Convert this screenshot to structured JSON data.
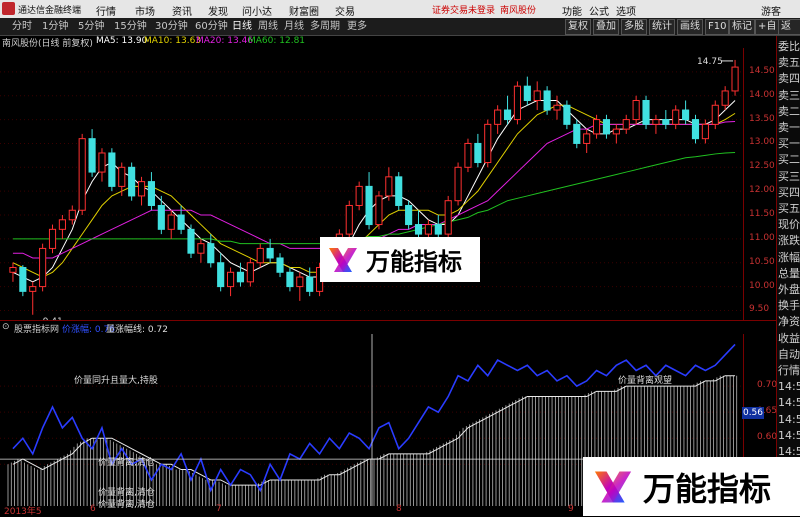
{
  "menubar": {
    "app_title": "通达信金融终端",
    "menus": [
      "行情",
      "市场",
      "资讯",
      "发现",
      "问小达",
      "财富圈",
      "交易"
    ],
    "notice": "证券交易未登录",
    "stock": "南风股份",
    "right": [
      "功能",
      "公式",
      "选项"
    ],
    "guest": "游客"
  },
  "toolbar": {
    "periods": [
      "分时",
      "1分钟",
      "5分钟",
      "15分钟",
      "30分钟",
      "60分钟",
      "日线",
      "周线",
      "月线",
      "多周期",
      "更多"
    ],
    "selected": "日线",
    "buttons": [
      "复权",
      "叠加",
      "多股",
      "统计",
      "画线",
      "F10",
      "标记",
      "+自选",
      "返回"
    ]
  },
  "chart_header": {
    "name": "南风股份(日线 前复权)",
    "ma": [
      {
        "label": "MA5: 13.90",
        "color": "#ffffff"
      },
      {
        "label": "MA10: 13.63",
        "color": "#e0d000"
      },
      {
        "label": "MA20: 13.46",
        "color": "#e020e0"
      },
      {
        "label": "MA60: 12.81",
        "color": "#20c020"
      }
    ]
  },
  "price_axis": [
    "14.50",
    "14.00",
    "13.50",
    "13.00",
    "12.50",
    "12.00",
    "11.50",
    "11.00",
    "10.50",
    "10.00",
    "9.50"
  ],
  "price_labels": {
    "high": "14.75",
    "low": "9.41"
  },
  "right_panel": [
    "委比",
    "卖五",
    "卖四",
    "卖三",
    "卖二",
    "卖一",
    "买一",
    "买二",
    "买三",
    "买四",
    "买五",
    "现价",
    "涨跌",
    "涨幅",
    "总量",
    "外盘",
    "换手",
    "净资",
    "收益",
    "自动",
    "行情",
    "14:5",
    "14:5",
    "14:5",
    "14:5",
    "14:5",
    "14:5",
    "14:5",
    "14:5"
  ],
  "indicator": {
    "name": "股票指标网",
    "line1": "价涨幅: 0.76",
    "line2": "量涨幅线: 0.72",
    "axis": [
      "0.70",
      "0.65",
      "0.60",
      "0.55",
      "0.50"
    ],
    "readout": "0.56",
    "annotations": [
      "价量同升且量大,持股",
      "价量背离,清仓",
      "价量背离,清仓",
      "价量背离,清仓",
      "价量背离观望"
    ]
  },
  "dates": [
    "2013年5",
    "6",
    "7",
    "8",
    "9",
    "10"
  ],
  "watermark": "万能指标",
  "chart_data": {
    "type": "candlestick",
    "y_range": [
      9.3,
      15.0
    ],
    "candles": [
      [
        10.3,
        10.5,
        10.1,
        10.4
      ],
      [
        10.4,
        10.45,
        9.8,
        9.9
      ],
      [
        9.9,
        10.1,
        9.41,
        10.0
      ],
      [
        10.0,
        10.9,
        9.9,
        10.8
      ],
      [
        10.8,
        11.3,
        10.7,
        11.2
      ],
      [
        11.2,
        11.5,
        11.0,
        11.4
      ],
      [
        11.4,
        11.7,
        11.3,
        11.6
      ],
      [
        11.6,
        13.2,
        11.5,
        13.1
      ],
      [
        13.1,
        13.3,
        12.3,
        12.4
      ],
      [
        12.4,
        12.9,
        12.2,
        12.8
      ],
      [
        12.8,
        12.9,
        12.0,
        12.1
      ],
      [
        12.1,
        12.6,
        11.9,
        12.5
      ],
      [
        12.5,
        12.6,
        11.8,
        11.9
      ],
      [
        11.9,
        12.3,
        11.7,
        12.2
      ],
      [
        12.2,
        12.4,
        11.6,
        11.7
      ],
      [
        11.7,
        11.9,
        11.1,
        11.2
      ],
      [
        11.2,
        11.6,
        11.0,
        11.5
      ],
      [
        11.5,
        11.7,
        11.1,
        11.2
      ],
      [
        11.2,
        11.3,
        10.6,
        10.7
      ],
      [
        10.7,
        11.0,
        10.5,
        10.9
      ],
      [
        10.9,
        11.1,
        10.4,
        10.5
      ],
      [
        10.5,
        10.7,
        9.9,
        10.0
      ],
      [
        10.0,
        10.4,
        9.8,
        10.3
      ],
      [
        10.3,
        10.5,
        10.0,
        10.1
      ],
      [
        10.1,
        10.6,
        10.0,
        10.5
      ],
      [
        10.5,
        10.9,
        10.4,
        10.8
      ],
      [
        10.8,
        11.0,
        10.5,
        10.6
      ],
      [
        10.6,
        10.7,
        10.2,
        10.3
      ],
      [
        10.3,
        10.4,
        9.9,
        10.0
      ],
      [
        10.0,
        10.3,
        9.7,
        10.2
      ],
      [
        10.2,
        10.4,
        9.8,
        9.9
      ],
      [
        9.9,
        10.5,
        9.8,
        10.4
      ],
      [
        10.4,
        10.9,
        10.3,
        10.8
      ],
      [
        10.8,
        11.2,
        10.6,
        11.1
      ],
      [
        11.1,
        11.8,
        11.0,
        11.7
      ],
      [
        11.7,
        12.2,
        11.6,
        12.1
      ],
      [
        12.1,
        12.4,
        11.2,
        11.3
      ],
      [
        11.3,
        12.0,
        11.2,
        11.9
      ],
      [
        11.9,
        12.5,
        11.8,
        12.3
      ],
      [
        12.3,
        12.4,
        11.6,
        11.7
      ],
      [
        11.7,
        11.8,
        11.2,
        11.3
      ],
      [
        11.3,
        11.6,
        11.0,
        11.1
      ],
      [
        11.1,
        11.4,
        10.9,
        11.3
      ],
      [
        11.3,
        11.5,
        11.0,
        11.1
      ],
      [
        11.1,
        11.9,
        11.0,
        11.8
      ],
      [
        11.8,
        12.6,
        11.7,
        12.5
      ],
      [
        12.5,
        13.1,
        12.4,
        13.0
      ],
      [
        13.0,
        13.2,
        12.5,
        12.6
      ],
      [
        12.6,
        13.5,
        12.5,
        13.4
      ],
      [
        13.4,
        13.8,
        13.2,
        13.7
      ],
      [
        13.7,
        14.0,
        13.4,
        13.5
      ],
      [
        13.5,
        14.3,
        13.4,
        14.2
      ],
      [
        14.2,
        14.4,
        13.8,
        13.9
      ],
      [
        13.9,
        14.3,
        13.7,
        14.1
      ],
      [
        14.1,
        14.2,
        13.6,
        13.7
      ],
      [
        13.7,
        14.0,
        13.5,
        13.8
      ],
      [
        13.8,
        13.9,
        13.3,
        13.4
      ],
      [
        13.4,
        13.5,
        12.9,
        13.0
      ],
      [
        13.0,
        13.3,
        12.8,
        13.2
      ],
      [
        13.2,
        13.6,
        13.1,
        13.5
      ],
      [
        13.5,
        13.6,
        13.1,
        13.2
      ],
      [
        13.2,
        13.4,
        13.0,
        13.3
      ],
      [
        13.3,
        13.6,
        13.2,
        13.5
      ],
      [
        13.5,
        14.0,
        13.4,
        13.9
      ],
      [
        13.9,
        14.0,
        13.3,
        13.4
      ],
      [
        13.4,
        13.6,
        13.2,
        13.5
      ],
      [
        13.5,
        13.7,
        13.3,
        13.4
      ],
      [
        13.4,
        13.8,
        13.3,
        13.7
      ],
      [
        13.7,
        13.9,
        13.4,
        13.5
      ],
      [
        13.5,
        13.6,
        13.0,
        13.1
      ],
      [
        13.1,
        13.5,
        13.0,
        13.4
      ],
      [
        13.4,
        13.9,
        13.3,
        13.8
      ],
      [
        13.8,
        14.2,
        13.7,
        14.1
      ],
      [
        14.1,
        14.75,
        14.0,
        14.6
      ]
    ],
    "ma": {
      "MA5": {
        "color": "#ffffff",
        "values": [
          10.3,
          10.2,
          10.1,
          10.2,
          10.4,
          10.8,
          11.2,
          11.8,
          12.2,
          12.5,
          12.6,
          12.4,
          12.3,
          12.1,
          12.0,
          11.8,
          11.6,
          11.4,
          11.2,
          11.0,
          10.9,
          10.7,
          10.5,
          10.4,
          10.3,
          10.4,
          10.5,
          10.5,
          10.4,
          10.3,
          10.2,
          10.2,
          10.4,
          10.6,
          10.9,
          11.3,
          11.6,
          11.8,
          11.9,
          11.9,
          11.8,
          11.6,
          11.4,
          11.3,
          11.3,
          11.5,
          11.9,
          12.3,
          12.7,
          13.1,
          13.4,
          13.7,
          13.8,
          13.9,
          13.9,
          13.9,
          13.7,
          13.5,
          13.3,
          13.2,
          13.2,
          13.3,
          13.3,
          13.4,
          13.5,
          13.5,
          13.5,
          13.5,
          13.5,
          13.4,
          13.4,
          13.5,
          13.7,
          13.9
        ]
      },
      "MA10": {
        "color": "#e0d000",
        "values": [
          10.5,
          10.4,
          10.3,
          10.2,
          10.3,
          10.5,
          10.8,
          11.1,
          11.4,
          11.7,
          11.9,
          12.0,
          12.1,
          12.1,
          12.1,
          12.0,
          11.9,
          11.7,
          11.5,
          11.3,
          11.1,
          10.9,
          10.8,
          10.7,
          10.6,
          10.5,
          10.5,
          10.5,
          10.4,
          10.4,
          10.3,
          10.3,
          10.4,
          10.5,
          10.7,
          10.9,
          11.1,
          11.3,
          11.5,
          11.6,
          11.6,
          11.6,
          11.6,
          11.5,
          11.5,
          11.6,
          11.8,
          12.0,
          12.3,
          12.6,
          12.9,
          13.2,
          13.4,
          13.6,
          13.7,
          13.8,
          13.8,
          13.7,
          13.6,
          13.5,
          13.4,
          13.4,
          13.4,
          13.4,
          13.4,
          13.4,
          13.4,
          13.4,
          13.4,
          13.4,
          13.4,
          13.4,
          13.5,
          13.63
        ]
      },
      "MA20": {
        "color": "#e020e0",
        "values": [
          10.7,
          10.7,
          10.6,
          10.6,
          10.6,
          10.7,
          10.8,
          10.9,
          11.0,
          11.1,
          11.2,
          11.3,
          11.4,
          11.5,
          11.6,
          11.6,
          11.6,
          11.6,
          11.6,
          11.5,
          11.5,
          11.4,
          11.3,
          11.2,
          11.1,
          11.0,
          10.9,
          10.9,
          10.8,
          10.8,
          10.8,
          10.8,
          10.8,
          10.8,
          10.9,
          10.9,
          11.0,
          11.0,
          11.1,
          11.2,
          11.2,
          11.3,
          11.3,
          11.3,
          11.4,
          11.5,
          11.6,
          11.7,
          11.8,
          12.0,
          12.2,
          12.4,
          12.6,
          12.8,
          13.0,
          13.1,
          13.2,
          13.3,
          13.3,
          13.4,
          13.4,
          13.4,
          13.4,
          13.4,
          13.4,
          13.4,
          13.4,
          13.4,
          13.4,
          13.4,
          13.4,
          13.4,
          13.45,
          13.46
        ]
      },
      "MA60": {
        "color": "#20c020",
        "values": [
          11.0,
          11.0,
          11.0,
          11.0,
          11.0,
          11.0,
          11.0,
          11.0,
          11.0,
          11.0,
          11.0,
          11.0,
          11.0,
          11.0,
          11.0,
          11.0,
          11.0,
          11.0,
          11.0,
          11.0,
          11.0,
          10.95,
          10.95,
          10.9,
          10.9,
          10.9,
          10.9,
          10.9,
          10.9,
          10.9,
          10.9,
          10.9,
          10.9,
          10.95,
          11.0,
          11.0,
          11.05,
          11.05,
          11.1,
          11.1,
          11.15,
          11.2,
          11.25,
          11.3,
          11.35,
          11.4,
          11.45,
          11.55,
          11.6,
          11.7,
          11.8,
          11.85,
          11.9,
          11.95,
          12.0,
          12.05,
          12.1,
          12.15,
          12.2,
          12.25,
          12.3,
          12.35,
          12.4,
          12.45,
          12.5,
          12.55,
          12.6,
          12.65,
          12.7,
          12.72,
          12.75,
          12.78,
          12.8,
          12.81
        ]
      }
    },
    "indicator_series": {
      "bars": [
        0.55,
        0.56,
        0.55,
        0.54,
        0.55,
        0.56,
        0.57,
        0.59,
        0.6,
        0.6,
        0.6,
        0.59,
        0.58,
        0.57,
        0.56,
        0.55,
        0.55,
        0.54,
        0.54,
        0.53,
        0.52,
        0.52,
        0.51,
        0.51,
        0.51,
        0.51,
        0.52,
        0.52,
        0.52,
        0.52,
        0.52,
        0.52,
        0.53,
        0.53,
        0.54,
        0.55,
        0.56,
        0.56,
        0.57,
        0.57,
        0.57,
        0.57,
        0.57,
        0.58,
        0.59,
        0.6,
        0.62,
        0.63,
        0.64,
        0.65,
        0.66,
        0.67,
        0.68,
        0.68,
        0.68,
        0.68,
        0.68,
        0.68,
        0.68,
        0.69,
        0.69,
        0.69,
        0.7,
        0.7,
        0.7,
        0.7,
        0.7,
        0.7,
        0.7,
        0.7,
        0.71,
        0.71,
        0.72,
        0.72
      ],
      "line": [
        0.58,
        0.6,
        0.57,
        0.62,
        0.66,
        0.62,
        0.64,
        0.6,
        0.58,
        0.62,
        0.55,
        0.58,
        0.55,
        0.56,
        0.52,
        0.55,
        0.54,
        0.57,
        0.52,
        0.56,
        0.5,
        0.54,
        0.51,
        0.54,
        0.53,
        0.5,
        0.55,
        0.52,
        0.57,
        0.56,
        0.59,
        0.57,
        0.6,
        0.58,
        0.61,
        0.6,
        0.58,
        0.62,
        0.63,
        0.58,
        0.6,
        0.63,
        0.66,
        0.65,
        0.68,
        0.72,
        0.71,
        0.74,
        0.72,
        0.75,
        0.74,
        0.73,
        0.74,
        0.72,
        0.73,
        0.71,
        0.72,
        0.7,
        0.71,
        0.73,
        0.72,
        0.74,
        0.75,
        0.73,
        0.74,
        0.72,
        0.74,
        0.73,
        0.72,
        0.74,
        0.73,
        0.74,
        0.76,
        0.78
      ]
    }
  }
}
